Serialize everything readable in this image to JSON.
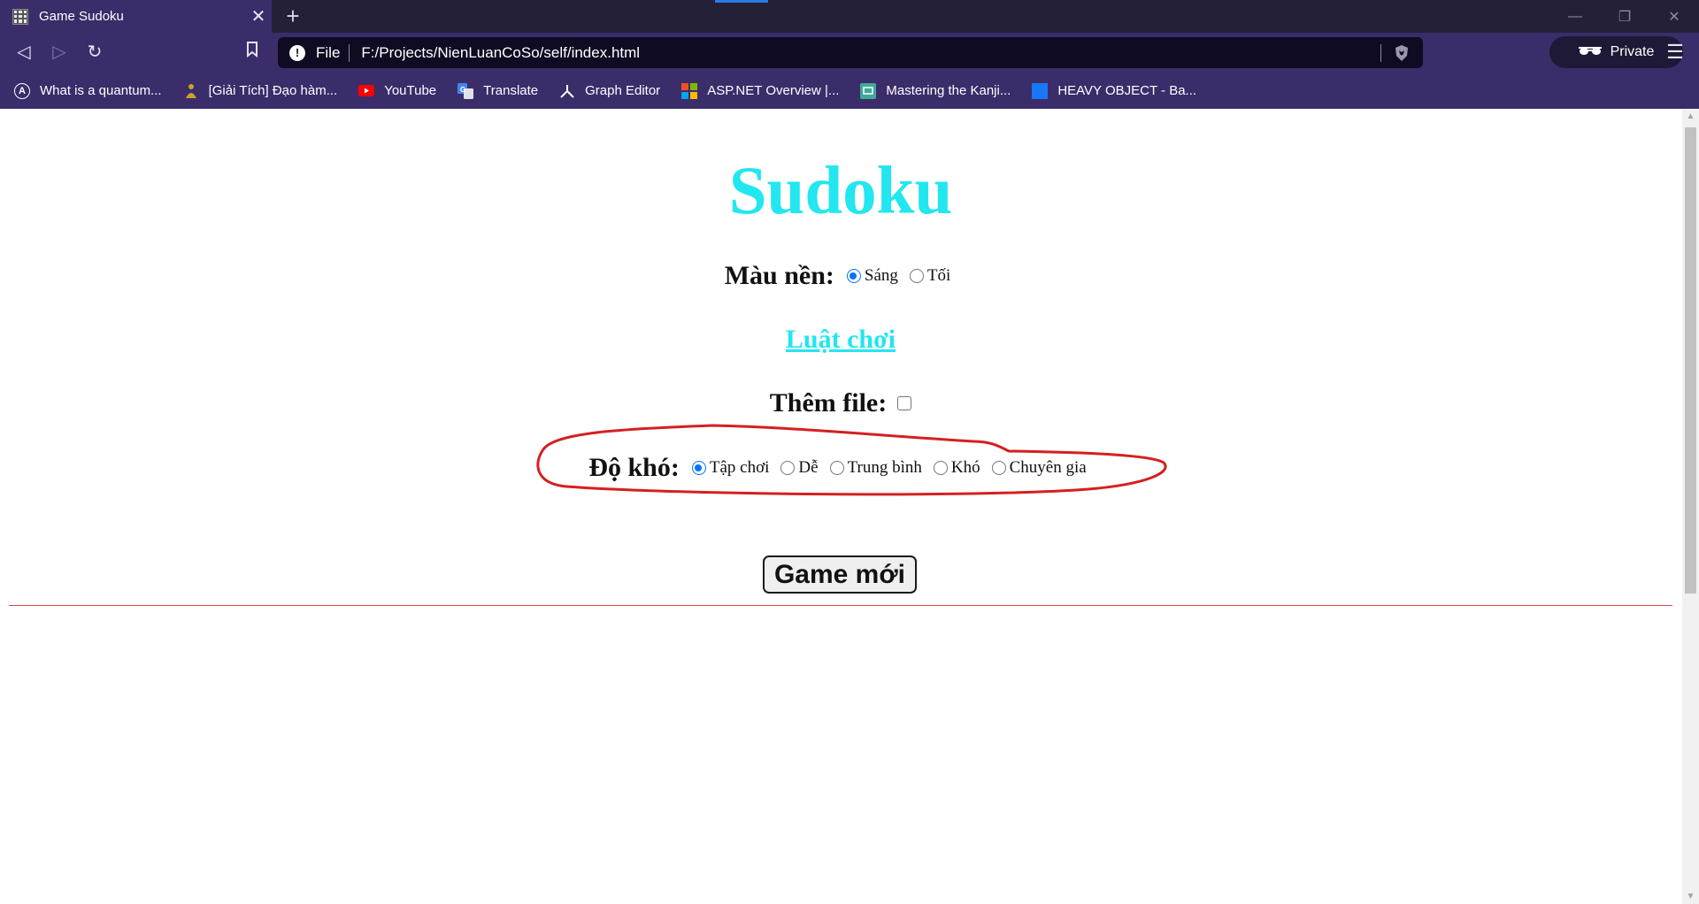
{
  "browser": {
    "tab_title": "Game Sudoku",
    "tab_close": "✕",
    "new_tab": "+",
    "url_scheme": "File",
    "url": "F:/Projects/NienLuanCoSo/self/index.html",
    "private_label": "Private",
    "bookmarks": [
      {
        "label": "What is a quantum...",
        "icon": "quantum-icon"
      },
      {
        "label": "[Giải Tích] Đạo hàm...",
        "icon": "buddha-icon"
      },
      {
        "label": "YouTube",
        "icon": "youtube-icon"
      },
      {
        "label": "Translate",
        "icon": "translate-icon"
      },
      {
        "label": "Graph Editor",
        "icon": "graph-editor-icon"
      },
      {
        "label": "ASP.NET Overview |...",
        "icon": "microsoft-icon"
      },
      {
        "label": "Mastering the Kanji...",
        "icon": "kanji-icon"
      },
      {
        "label": "HEAVY OBJECT - Ba...",
        "icon": "heavy-object-icon"
      }
    ],
    "colors": {
      "tabbar": "#242038",
      "toolbar": "#3a2d6a",
      "urlbar": "#0f0b23"
    }
  },
  "page": {
    "title": "Sudoku",
    "theme": {
      "label": "Màu nền:",
      "options": [
        {
          "label": "Sáng",
          "selected": true
        },
        {
          "label": "Tối",
          "selected": false
        }
      ]
    },
    "rules_link": "Luật chơi",
    "add_file": {
      "label": "Thêm file:",
      "checked": false
    },
    "difficulty": {
      "label": "Độ khó:",
      "options": [
        {
          "label": "Tập chơi",
          "selected": true
        },
        {
          "label": "Dễ",
          "selected": false
        },
        {
          "label": "Trung bình",
          "selected": false
        },
        {
          "label": "Khó",
          "selected": false
        },
        {
          "label": "Chuyên gia",
          "selected": false
        }
      ]
    },
    "new_game_button": "Game mới",
    "colors": {
      "title": "#22e6f0",
      "link": "#22e6f0",
      "divider": "#d94848",
      "annotation": "#d42020"
    }
  }
}
